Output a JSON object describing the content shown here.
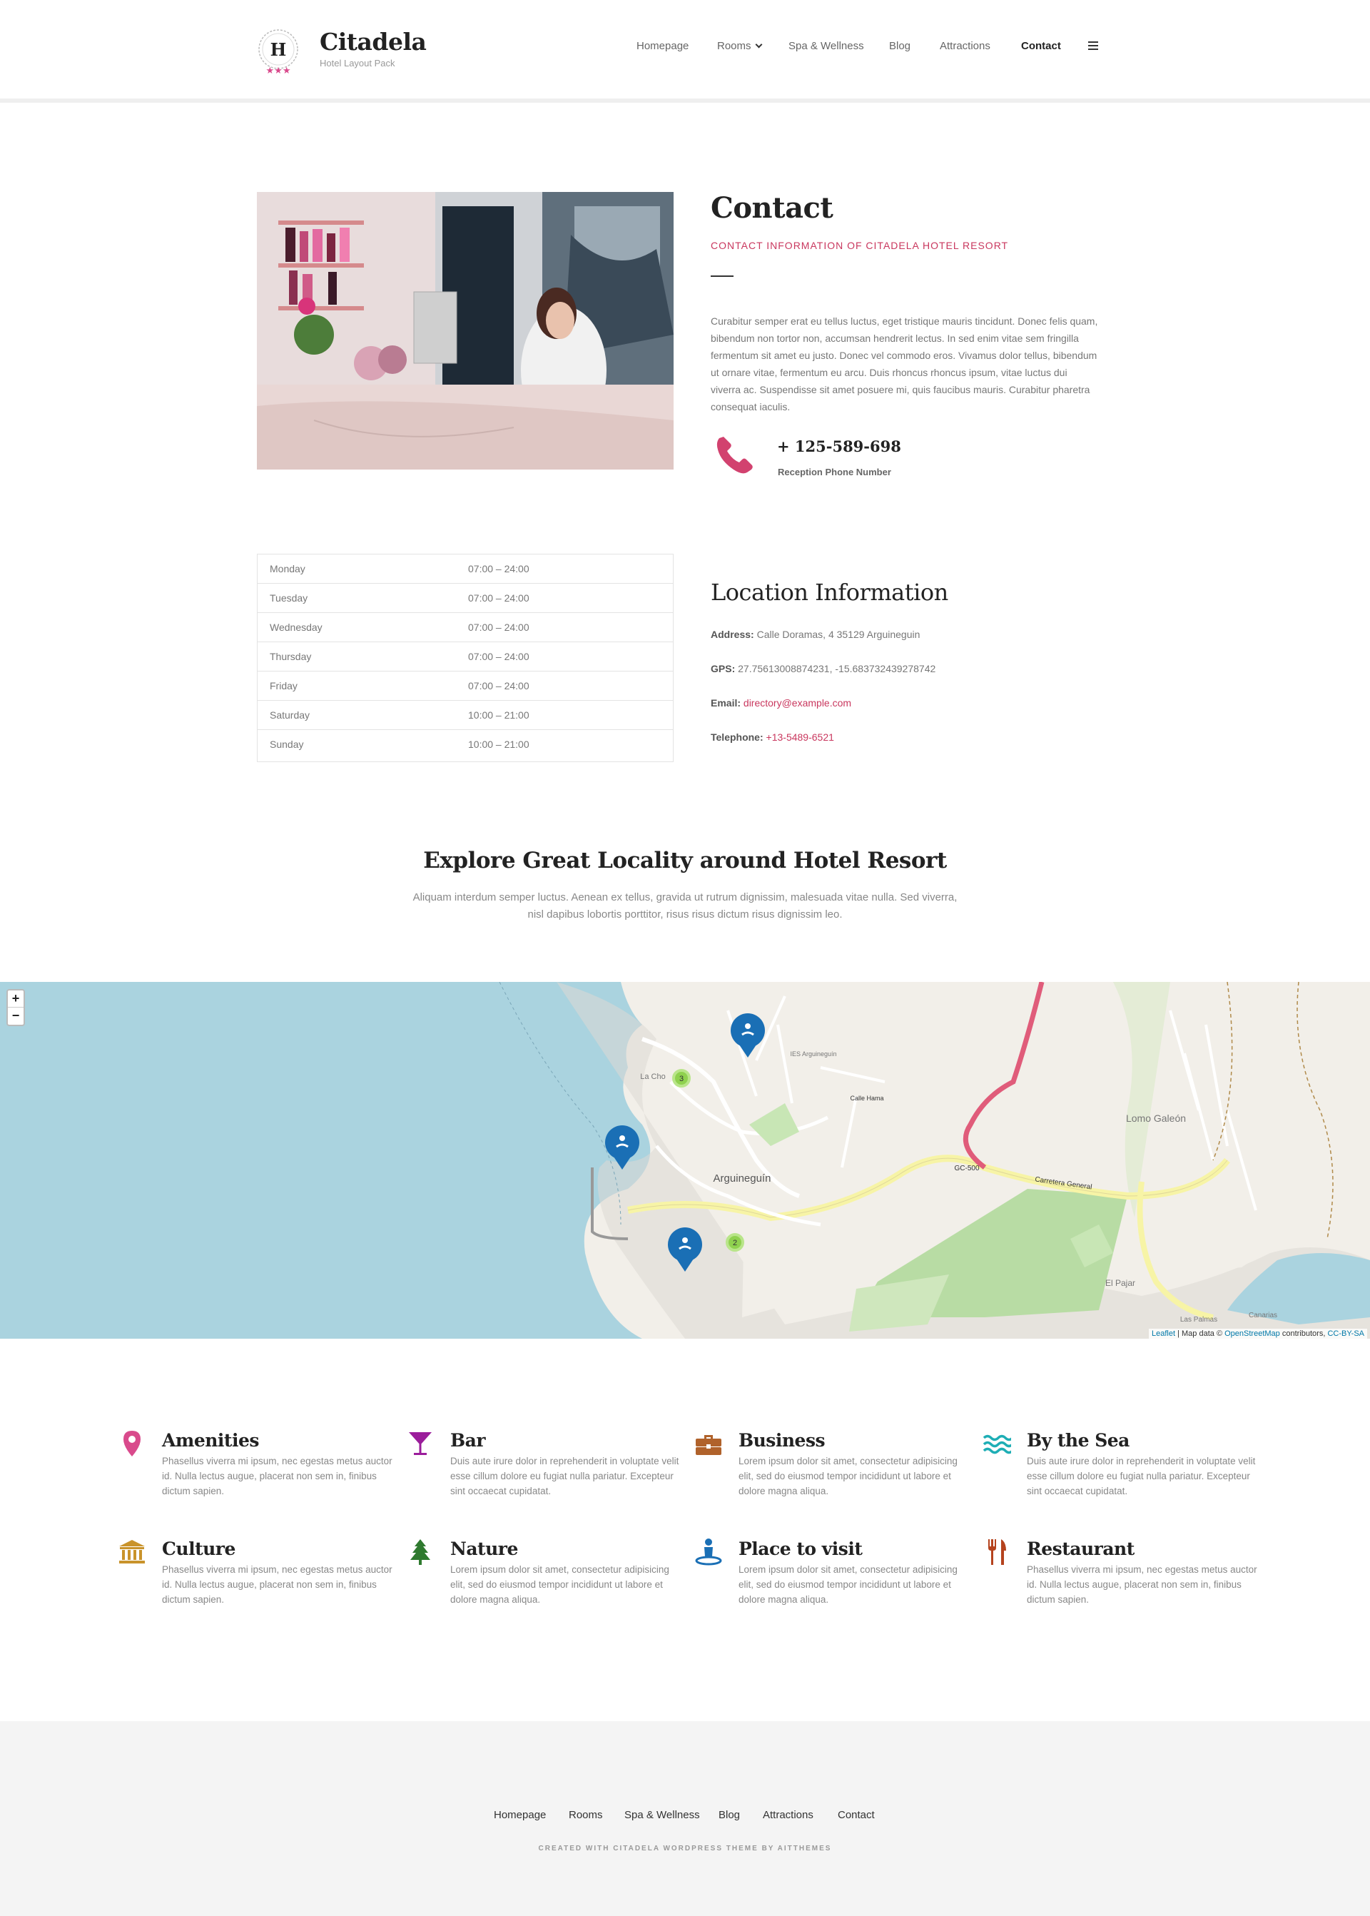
{
  "brand": {
    "title": "Citadela",
    "subtitle": "Hotel Layout Pack",
    "logo_letter": "H"
  },
  "nav": {
    "items": [
      "Homepage",
      "Rooms",
      "Spa & Wellness",
      "Blog",
      "Attractions",
      "Contact"
    ],
    "active": "Contact"
  },
  "contact": {
    "title": "Contact",
    "subtitle": "CONTACT INFORMATION OF CITADELA HOTEL RESORT",
    "paragraph": "Curabitur semper erat eu tellus luctus, eget tristique mauris tincidunt. Donec felis quam, bibendum non tortor non, accumsan hendrerit lectus. In sed enim vitae sem fringilla fermentum sit amet eu justo. Donec vel commodo eros. Vivamus dolor tellus, bibendum ut ornare vitae, fermentum eu arcu. Duis rhoncus rhoncus ipsum, vitae luctus dui viverra ac. Suspendisse sit amet posuere mi, quis faucibus mauris. Curabitur pharetra consequat iaculis.",
    "phone": "+ 125-589-698",
    "phone_label": "Reception Phone Number"
  },
  "hours": [
    {
      "day": "Monday",
      "time": "07:00 – 24:00"
    },
    {
      "day": "Tuesday",
      "time": "07:00 – 24:00"
    },
    {
      "day": "Wednesday",
      "time": "07:00 – 24:00"
    },
    {
      "day": "Thursday",
      "time": "07:00 – 24:00"
    },
    {
      "day": "Friday",
      "time": "07:00 – 24:00"
    },
    {
      "day": "Saturday",
      "time": "10:00 – 21:00"
    },
    {
      "day": "Sunday",
      "time": "10:00 – 21:00"
    }
  ],
  "location": {
    "title": "Location Information",
    "address_label": "Address:",
    "address": "Calle Doramas, 4 35129 Arguineguin",
    "gps_label": "GPS:",
    "gps": "27.75613008874231, -15.683732439278742",
    "email_label": "Email:",
    "email": "directory@example.com",
    "telephone_label": "Telephone:",
    "telephone": "+13-5489-6521"
  },
  "explore": {
    "title": "Explore Great Locality around Hotel Resort",
    "text": "Aliquam interdum semper luctus. Aenean ex tellus, gravida ut rutrum dignissim, malesuada vitae nulla. Sed viverra, nisl dapibus lobortis porttitor, risus risus dictum risus dignissim leo."
  },
  "map": {
    "zoom_in": "+",
    "zoom_out": "−",
    "labels": [
      "Arguineguín",
      "Lomo Galeón",
      "Carretera General",
      "GC-500",
      "El Pajar",
      "La Cho",
      "Calle Hama",
      "IES Arguineguín",
      "Las Palmas",
      "Canarias"
    ],
    "clusters": [
      "3",
      "2"
    ],
    "attribution_leaflet": "Leaflet",
    "attribution_mid": "| Map data ©",
    "attribution_osm": "OpenStreetMap",
    "attribution_contrib": "contributors,",
    "attribution_license": "CC-BY-SA"
  },
  "amenities": [
    {
      "title": "Amenities",
      "text": "Phasellus viverra mi ipsum, nec egestas metus auctor id. Nulla lectus augue, placerat non sem in, finibus dictum sapien.",
      "icon": "map-pin-icon",
      "color": "#d94a8c"
    },
    {
      "title": "Bar",
      "text": "Duis aute irure dolor in reprehenderit in voluptate velit esse cillum dolore eu fugiat nulla pariatur. Excepteur sint occaecat cupidatat.",
      "icon": "cocktail-icon",
      "color": "#9b1d9b"
    },
    {
      "title": "Business",
      "text": "Lorem ipsum dolor sit amet, consectetur adipisicing elit, sed do eiusmod tempor incididunt ut labore et dolore magna aliqua.",
      "icon": "briefcase-icon",
      "color": "#b0622b"
    },
    {
      "title": "By the Sea",
      "text": "Duis aute irure dolor in reprehenderit in voluptate velit esse cillum dolore eu fugiat nulla pariatur. Excepteur sint occaecat cupidatat.",
      "icon": "waves-icon",
      "color": "#1eaeb5"
    },
    {
      "title": "Culture",
      "text": "Phasellus viverra mi ipsum, nec egestas metus auctor id. Nulla lectus augue, placerat non sem in, finibus dictum sapien.",
      "icon": "museum-icon",
      "color": "#c9932b"
    },
    {
      "title": "Nature",
      "text": "Lorem ipsum dolor sit amet, consectetur adipisicing elit, sed do eiusmod tempor incididunt ut labore et dolore magna aliqua.",
      "icon": "tree-icon",
      "color": "#2f7a2f"
    },
    {
      "title": "Place to visit",
      "text": "Lorem ipsum dolor sit amet, consectetur adipisicing elit, sed do eiusmod tempor incididunt ut labore et dolore magna aliqua.",
      "icon": "person-pin-icon",
      "color": "#1a6fb5"
    },
    {
      "title": "Restaurant",
      "text": "Phasellus viverra mi ipsum, nec egestas metus auctor id. Nulla lectus augue, placerat non sem in, finibus dictum sapien.",
      "icon": "cutlery-icon",
      "color": "#b5431e"
    }
  ],
  "footer": {
    "nav": [
      "Homepage",
      "Rooms",
      "Spa & Wellness",
      "Blog",
      "Attractions",
      "Contact"
    ],
    "credit": "CREATED WITH CITADELA WORDPRESS THEME BY AITTHEMES"
  },
  "colors": {
    "accent": "#c9375e",
    "map_water": "#aad3df",
    "footer_bg": "#f4f4f4"
  }
}
